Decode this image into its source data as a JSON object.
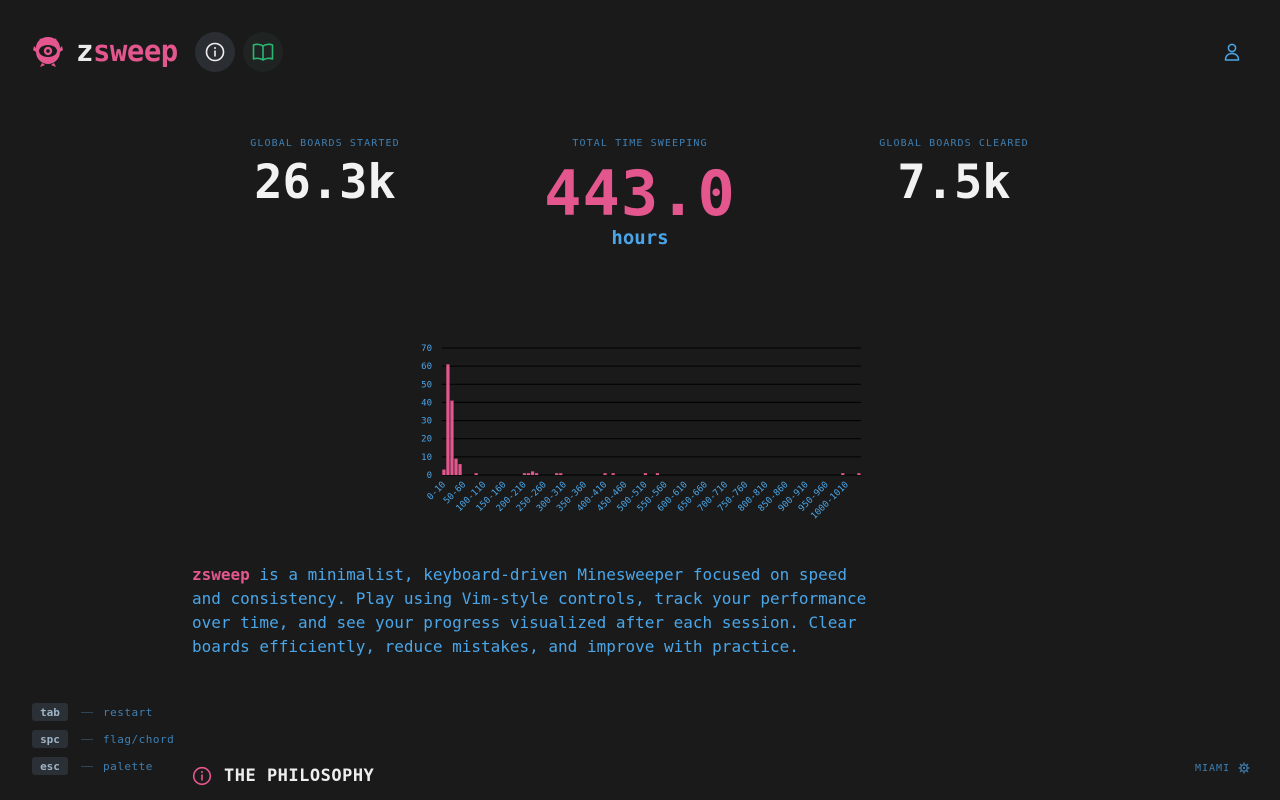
{
  "brand": {
    "z": "z",
    "sweep": "sweep"
  },
  "header": {
    "icons": {
      "mascot": "mascot-eye-icon",
      "info": "info-icon",
      "book": "book-icon",
      "user": "user-icon"
    }
  },
  "stats": {
    "left": {
      "label": "GLOBAL BOARDS STARTED",
      "value": "26.3k"
    },
    "center": {
      "label": "TOTAL TIME SWEEPING",
      "value": "443.0",
      "unit": "hours"
    },
    "right": {
      "label": "GLOBAL BOARDS CLEARED",
      "value": "7.5k"
    }
  },
  "chart_data": {
    "type": "bar",
    "ylim": [
      0,
      70
    ],
    "yticks": [
      0,
      10,
      20,
      30,
      40,
      50,
      60,
      70
    ],
    "grid": true,
    "bar_color": "#e4578e",
    "categories": [
      "0-10",
      "10-20",
      "20-30",
      "30-40",
      "40-50",
      "50-60",
      "60-70",
      "70-80",
      "80-90",
      "90-100",
      "100-110",
      "110-120",
      "120-130",
      "130-140",
      "140-150",
      "150-160",
      "160-170",
      "170-180",
      "180-190",
      "190-200",
      "200-210",
      "210-220",
      "220-230",
      "230-240",
      "240-250",
      "250-260",
      "260-270",
      "270-280",
      "280-290",
      "290-300",
      "300-310",
      "310-320",
      "320-330",
      "330-340",
      "340-350",
      "350-360",
      "360-370",
      "370-380",
      "380-390",
      "390-400",
      "400-410",
      "410-420",
      "420-430",
      "430-440",
      "440-450",
      "450-460",
      "460-470",
      "470-480",
      "480-490",
      "490-500",
      "500-510",
      "510-520",
      "520-530",
      "530-540",
      "540-550",
      "550-560",
      "560-570",
      "570-580",
      "580-590",
      "590-600",
      "600-610",
      "610-620",
      "620-630",
      "630-640",
      "640-650",
      "650-660",
      "660-670",
      "670-680",
      "680-690",
      "690-700",
      "700-710",
      "710-720",
      "720-730",
      "730-740",
      "740-750",
      "750-760",
      "760-770",
      "770-780",
      "780-790",
      "790-800",
      "800-810",
      "810-820",
      "820-830",
      "830-840",
      "840-850",
      "850-860",
      "860-870",
      "870-880",
      "880-890",
      "890-900",
      "900-910",
      "910-920",
      "920-930",
      "930-940",
      "940-950",
      "950-960",
      "960-970",
      "970-980",
      "980-990",
      "990-1000",
      "1000-1010",
      "1010-1020",
      "1020-1030",
      "1030-1040"
    ],
    "values": [
      3,
      61,
      41,
      9,
      6,
      0,
      0,
      0,
      1,
      0,
      0,
      0,
      0,
      0,
      0,
      0,
      0,
      0,
      0,
      0,
      1,
      1,
      2,
      1,
      0,
      0,
      0,
      0,
      1,
      1,
      0,
      0,
      0,
      0,
      0,
      0,
      0,
      0,
      0,
      0,
      1,
      0,
      1,
      0,
      0,
      0,
      0,
      0,
      0,
      0,
      1,
      0,
      0,
      1,
      0,
      0,
      0,
      0,
      0,
      0,
      0,
      0,
      0,
      0,
      0,
      0,
      0,
      0,
      0,
      0,
      0,
      0,
      0,
      0,
      0,
      0,
      0,
      0,
      0,
      0,
      0,
      0,
      0,
      0,
      0,
      0,
      0,
      0,
      0,
      0,
      0,
      0,
      0,
      0,
      0,
      0,
      0,
      0,
      0,
      1,
      0,
      0,
      0,
      1
    ],
    "xtick_labels": [
      "0-10",
      "50-60",
      "100-110",
      "150-160",
      "200-210",
      "250-260",
      "300-310",
      "350-360",
      "400-410",
      "450-460",
      "500-510",
      "550-560",
      "600-610",
      "650-660",
      "700-710",
      "750-760",
      "800-810",
      "850-860",
      "900-910",
      "950-960",
      "1000-1010"
    ]
  },
  "description": {
    "brand": "zsweep",
    "text": " is a minimalist, keyboard-driven Minesweeper focused on speed and consistency. Play using Vim-style controls, track your performance over time, and see your progress visualized after each session. Clear boards efficiently, reduce mistakes, and improve with practice."
  },
  "shortcuts": [
    {
      "key": "tab",
      "label": "restart"
    },
    {
      "key": "spc",
      "label": "flag/chord"
    },
    {
      "key": "esc",
      "label": "palette"
    }
  ],
  "philosophy": {
    "title": "THE PHILOSOPHY",
    "icon": "info-icon"
  },
  "location": {
    "label": "MIAMI",
    "icon": "gear-icon"
  }
}
